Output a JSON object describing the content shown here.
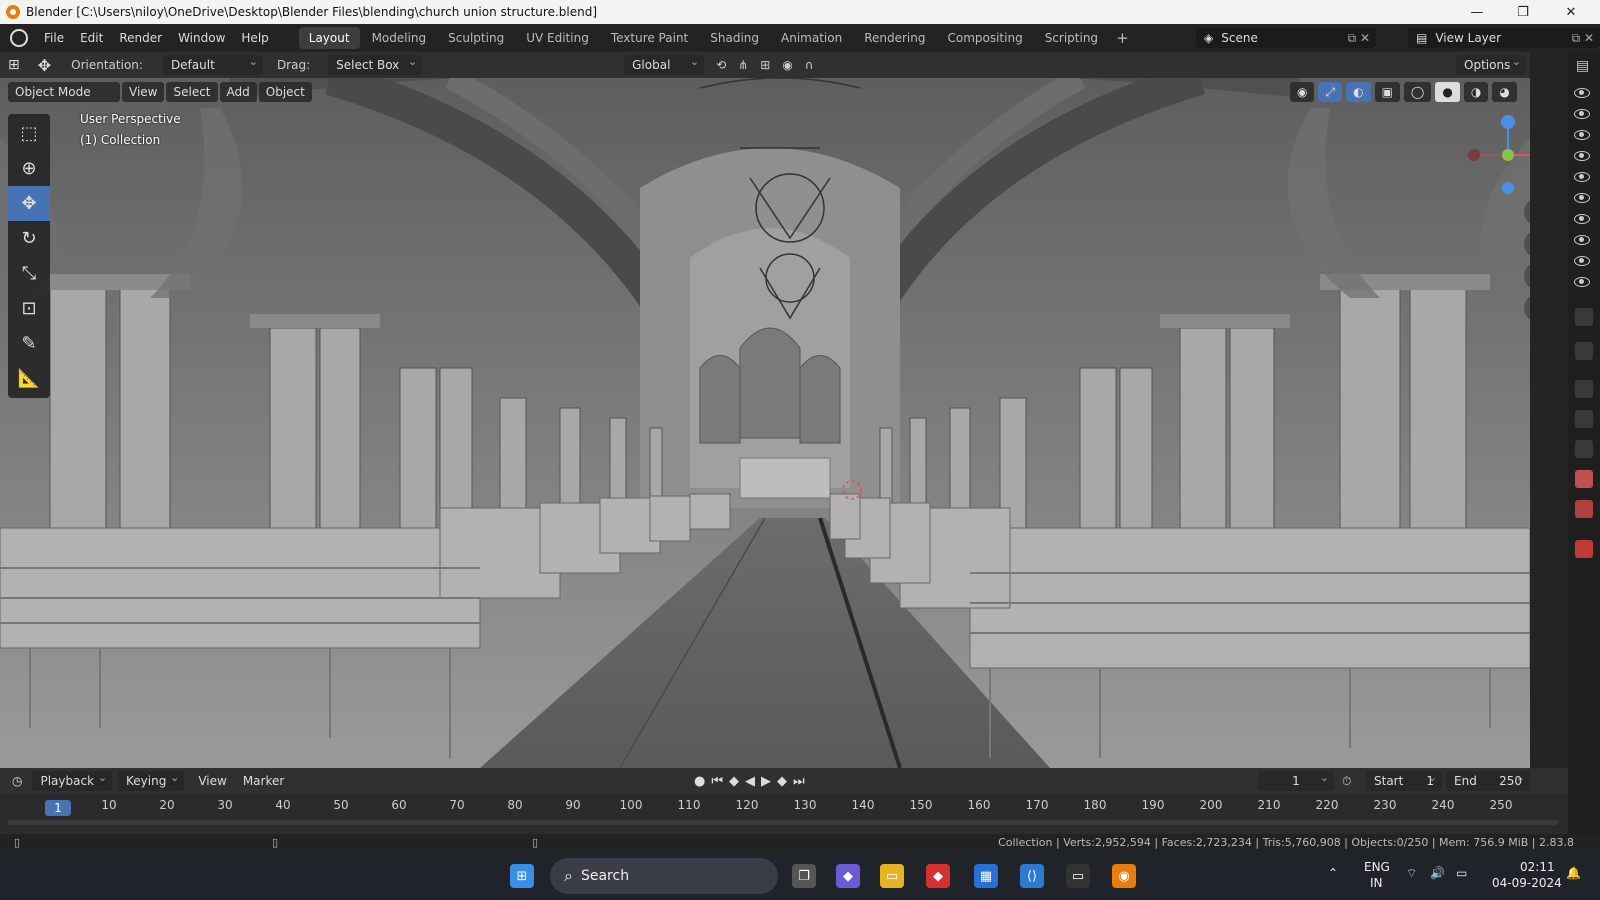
{
  "window": {
    "title": "Blender [C:\\Users\\niloy\\OneDrive\\Desktop\\Blender Files\\blending\\church union structure.blend]"
  },
  "menu": {
    "items": [
      "File",
      "Edit",
      "Render",
      "Window",
      "Help"
    ]
  },
  "workspaces": [
    "Layout",
    "Modeling",
    "Sculpting",
    "UV Editing",
    "Texture Paint",
    "Shading",
    "Animation",
    "Rendering",
    "Compositing",
    "Scripting"
  ],
  "scene": {
    "name": "Scene",
    "view_layer": "View Layer"
  },
  "tool_header": {
    "orientation_label": "Orientation:",
    "orientation_value": "Default",
    "drag_label": "Drag:",
    "drag_value": "Select Box",
    "transform_orientation": "Global",
    "options_label": "Options"
  },
  "viewport": {
    "mode": "Object Mode",
    "menus": [
      "View",
      "Select",
      "Add",
      "Object"
    ],
    "overlay_line1": "User Perspective",
    "overlay_line2": "(1) Collection"
  },
  "timeline": {
    "menus": [
      "Playback",
      "Keying",
      "View",
      "Marker"
    ],
    "current_frame": "1",
    "start_label": "Start",
    "start_value": "1",
    "end_label": "End",
    "end_value": "250",
    "ticks": [
      "10",
      "20",
      "30",
      "40",
      "50",
      "60",
      "70",
      "80",
      "90",
      "100",
      "110",
      "120",
      "130",
      "140",
      "150",
      "160",
      "170",
      "180",
      "190",
      "200",
      "210",
      "220",
      "230",
      "240",
      "250"
    ]
  },
  "status": {
    "text": "Collection | Verts:2,952,594 | Faces:2,723,234 | Tris:5,760,908 | Objects:0/250 | Mem: 756.9 MiB | 2.83.8"
  },
  "taskbar": {
    "search": "Search",
    "lang1": "ENG",
    "lang2": "IN",
    "time": "02:11",
    "date": "04-09-2024"
  },
  "colors": {
    "accent": "#4772b3",
    "axis_x": "#e84a5f",
    "axis_y": "#8bc34a",
    "axis_z": "#4a90e2"
  }
}
